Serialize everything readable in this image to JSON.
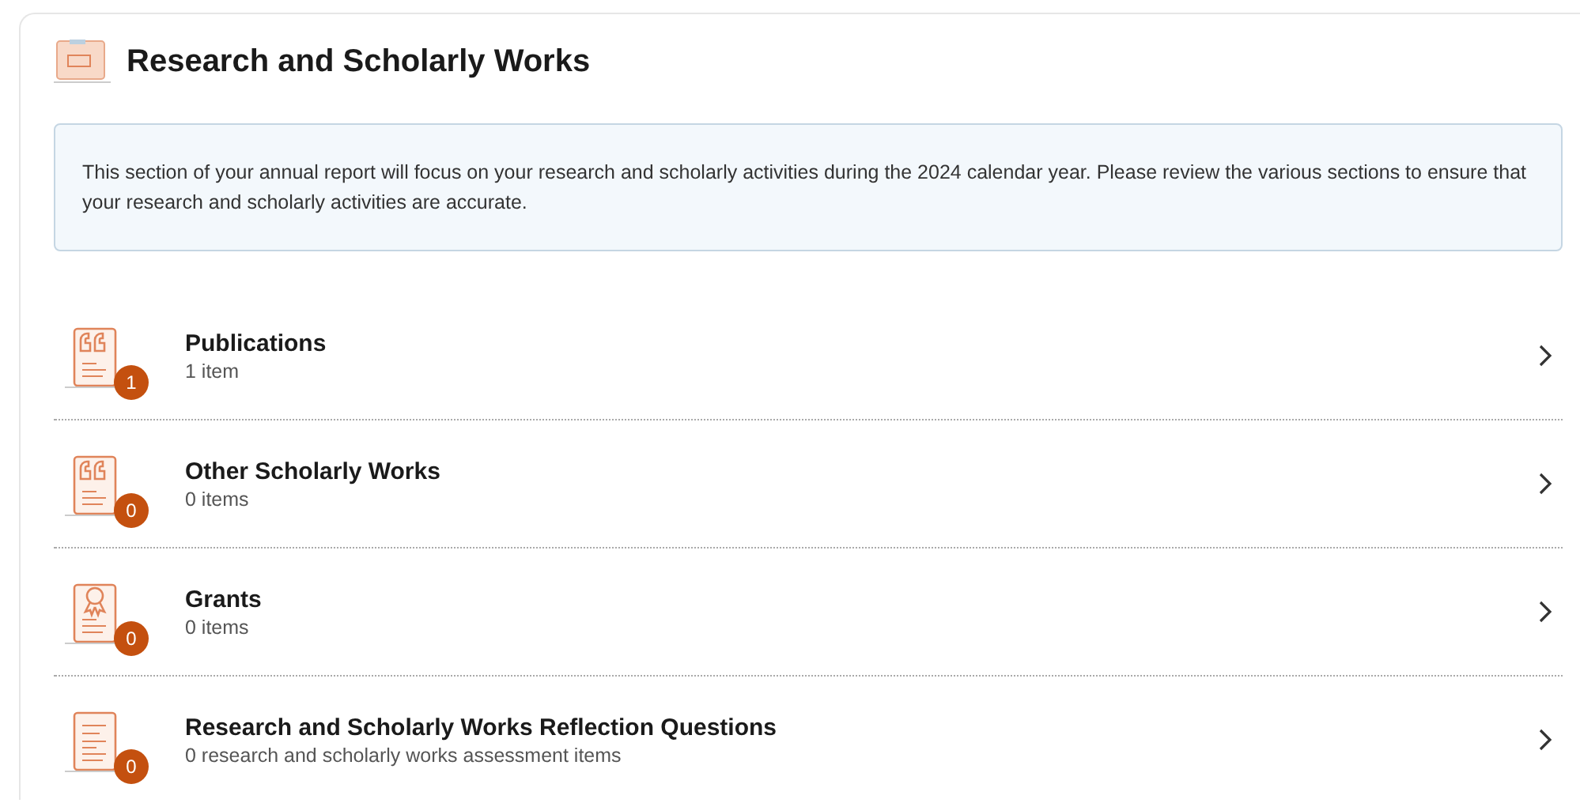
{
  "header": {
    "title": "Research and Scholarly Works"
  },
  "info": "This section of your annual report will focus on your research and scholarly activities during the 2024 calendar year.  Please review the various sections to ensure that your research and scholarly activities are accurate.",
  "sections": [
    {
      "kind": "quote",
      "title": "Publications",
      "subtitle": "1 item",
      "count": "1"
    },
    {
      "kind": "quote",
      "title": "Other Scholarly Works",
      "subtitle": "0 items",
      "count": "0"
    },
    {
      "kind": "award",
      "title": "Grants",
      "subtitle": "0 items",
      "count": "0"
    },
    {
      "kind": "document",
      "title": "Research and Scholarly Works Reflection Questions",
      "subtitle": "0 research and scholarly works assessment items",
      "count": "0"
    }
  ]
}
